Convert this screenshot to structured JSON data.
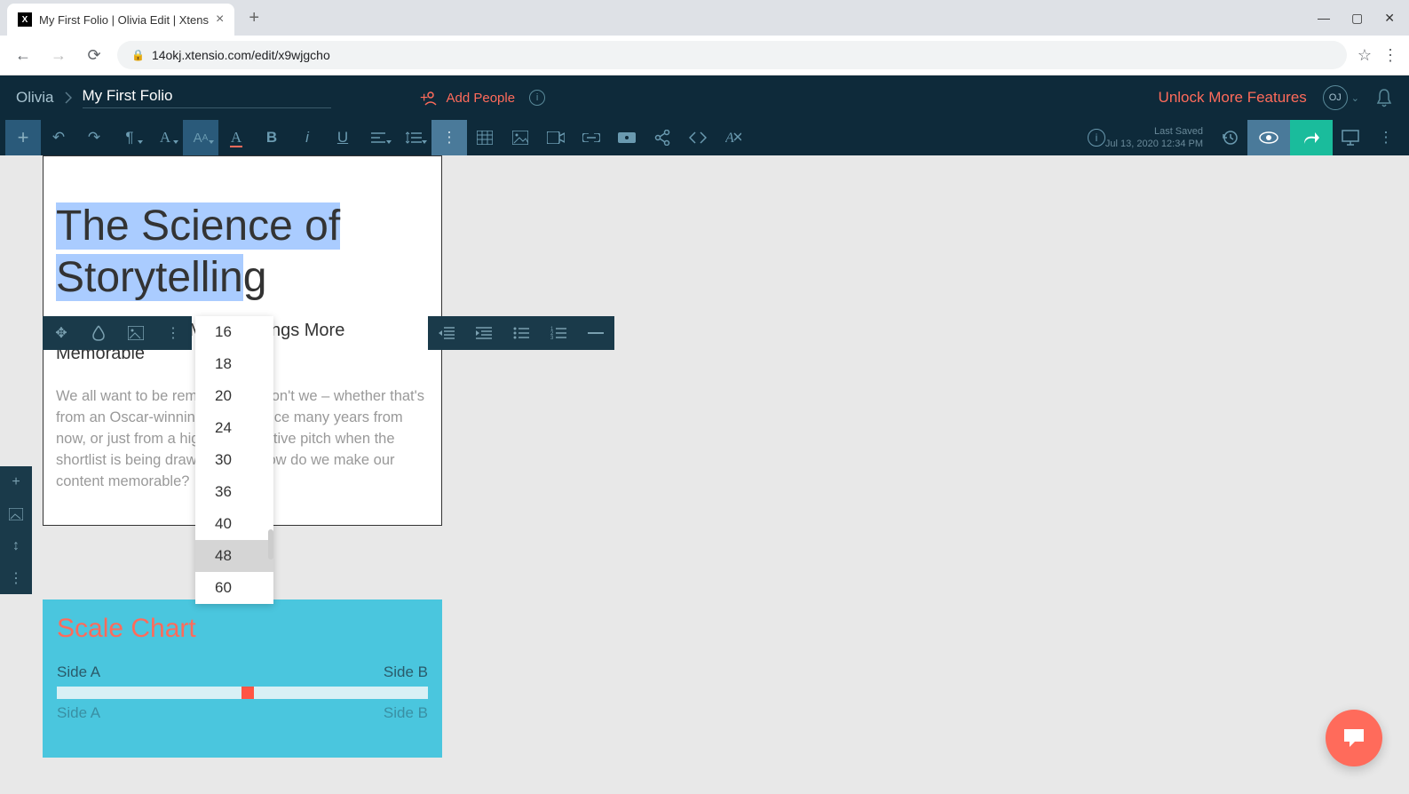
{
  "browser": {
    "tab_title": "My First Folio | Olivia Edit | Xtens",
    "url": "14okj.xtensio.com/edit/x9wjgcho"
  },
  "header": {
    "user": "Olivia",
    "folio_title": "My First Folio",
    "add_people": "Add People",
    "unlock": "Unlock More Features",
    "avatar_initials": "OJ"
  },
  "toolbar": {
    "last_saved_label": "Last Saved",
    "last_saved_time": "Jul 13, 2020 12:34 PM"
  },
  "font_sizes": [
    "16",
    "18",
    "20",
    "24",
    "30",
    "36",
    "40",
    "48",
    "60"
  ],
  "font_size_selected": "48",
  "document": {
    "headline_line1": "The Science of",
    "headline_line2_a": "Storytell",
    "headline_line2_b": "in",
    "headline_line2_c": "g",
    "subhead": "How Storytelling Makes Things More Memorable",
    "body": "We all want to be remembered, don't we – whether that's from an Oscar-winning performance many years from now, or just from a highly competitive pitch when the shortlist is being drawn up. But how do we make our content memorable?"
  },
  "chart": {
    "title": "Scale Chart",
    "side_a": "Side A",
    "side_b": "Side B",
    "side_a2": "Side A",
    "side_b2": "Side B"
  },
  "chart_data": {
    "type": "bar",
    "title": "Scale Chart",
    "series": [
      {
        "left_label": "Side A",
        "right_label": "Side B",
        "value": 51,
        "min": 0,
        "max": 100
      }
    ]
  }
}
